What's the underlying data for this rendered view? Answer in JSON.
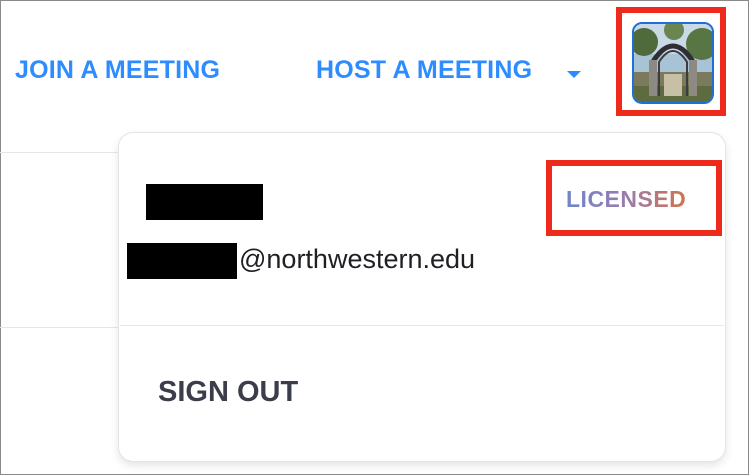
{
  "nav": {
    "join_label": "JOIN A MEETING",
    "host_label": "HOST A MEETING"
  },
  "account_menu": {
    "email_domain": "@northwestern.edu",
    "license_badge": "LICENSED",
    "sign_out_label": "SIGN OUT"
  },
  "colors": {
    "link_blue": "#2d8cff",
    "highlight_red": "#ee2a1b",
    "text_dark": "#3b3e4a"
  },
  "icons": {
    "avatar": "profile-photo-gate",
    "caret": "chevron-down-icon"
  }
}
